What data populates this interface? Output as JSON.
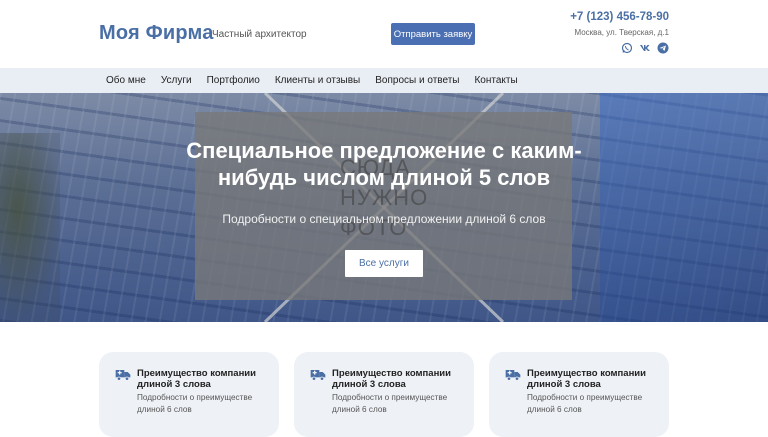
{
  "header": {
    "brand": "Моя Фирма",
    "tagline": "Частный архитектор",
    "cta_label": "Отправить заявку",
    "phone": "+7 (123) 456-78-90",
    "address": "Москва, ул. Тверская, д.1",
    "socials": [
      "whatsapp-icon",
      "vk-icon",
      "telegram-icon"
    ],
    "accent_color": "#4a6fa5"
  },
  "nav": {
    "items": [
      {
        "label": "Обо мне"
      },
      {
        "label": "Услуги"
      },
      {
        "label": "Портфолио"
      },
      {
        "label": "Клиенты и отзывы"
      },
      {
        "label": "Вопросы и ответы"
      },
      {
        "label": "Контакты"
      }
    ]
  },
  "hero": {
    "placeholder": "СЮДА НУЖНО ФОТО",
    "title": "Специальное предложение с каким-нибудь числом длиной 5 слов",
    "subtitle": "Подробности о специальном предложении длиной 6 слов",
    "button_label": "Все услуги"
  },
  "cards": [
    {
      "icon": "truck-icon",
      "title": "Преимущество компании длиной 3 слова",
      "text": "Подробности о преимуществе длиной 6 слов"
    },
    {
      "icon": "truck-icon",
      "title": "Преимущество компании длиной 3 слова",
      "text": "Подробности о преимуществе длиной 6 слов"
    },
    {
      "icon": "truck-icon",
      "title": "Преимущество компании длиной 3 слова",
      "text": "Подробности о преимуществе длиной 6 слов"
    }
  ]
}
